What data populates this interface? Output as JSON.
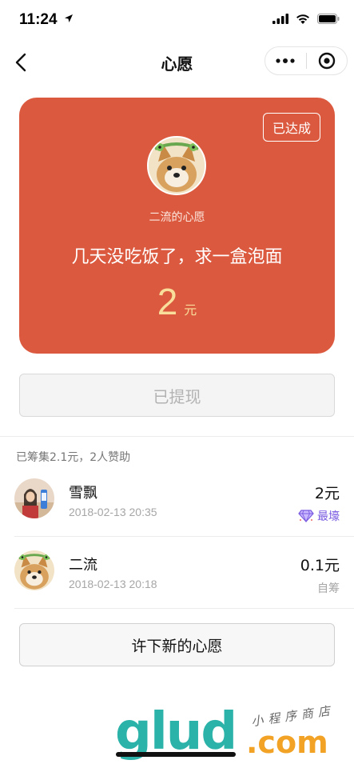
{
  "status_bar": {
    "time": "11:24"
  },
  "nav": {
    "title": "心愿"
  },
  "wish": {
    "badge": "已达成",
    "owner": "二流的心愿",
    "text": "几天没吃饭了，求一盒泡面",
    "amount": "2",
    "unit": "元"
  },
  "withdraw_label": "已提现",
  "summary": "已筹集2.1元，2人赞助",
  "sponsors": [
    {
      "name": "雪飘",
      "time": "2018-02-13 20:35",
      "amount": "2元",
      "tag": "最壕",
      "tag_icon": "diamond-icon"
    },
    {
      "name": "二流",
      "time": "2018-02-13 20:18",
      "amount": "0.1元",
      "tag": "自筹"
    }
  ],
  "new_wish_label": "许下新的心愿",
  "watermark": {
    "logo": "glud",
    "domain": ".com",
    "subtitle": "小程序商店"
  },
  "colors": {
    "card": "#db5a3f",
    "amount": "#f8dd9b",
    "best_tag": "#7a5be0",
    "wm_green": "#2bb3a9",
    "wm_orange": "#f2a224"
  }
}
